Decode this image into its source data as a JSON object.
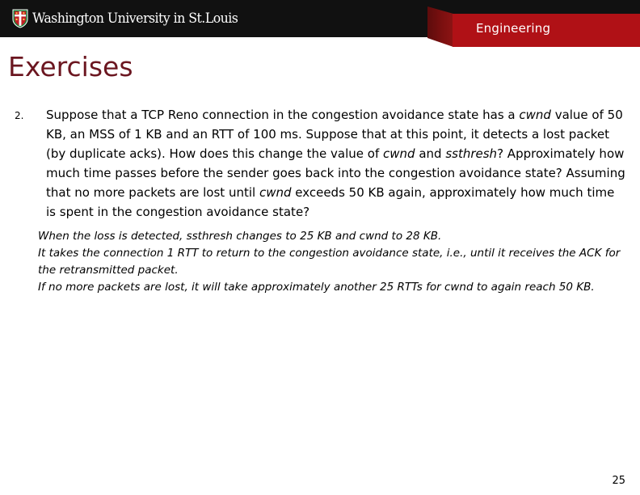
{
  "header": {
    "university_name": "Washington University in St.Louis",
    "crest_icon": "shield-crest-icon",
    "school_label": "Engineering",
    "bar_color": "#111111",
    "banner_color": "#b01116",
    "banner_fold_color": "#5d0c0c"
  },
  "slide": {
    "title": "Exercises",
    "title_color": "#6b1620",
    "page_number": "25"
  },
  "question": {
    "number": "2.",
    "segments": [
      {
        "text": "Suppose that a TCP Reno connection in the congestion avoidance state has a ",
        "italic": false
      },
      {
        "text": "cwnd",
        "italic": true
      },
      {
        "text": " value of 50 KB, an MSS of 1 KB and an RTT of 100 ms. Suppose that at this point, it detects a lost packet (by duplicate acks). How does this change the value of ",
        "italic": false
      },
      {
        "text": "cwnd",
        "italic": true
      },
      {
        "text": " and ",
        "italic": false
      },
      {
        "text": "ssthresh",
        "italic": true
      },
      {
        "text": "? Approximately how much time passes before the sender goes back into the congestion avoidance state? Assuming that no more packets are lost until ",
        "italic": false
      },
      {
        "text": "cwnd",
        "italic": true
      },
      {
        "text": " exceeds 50 KB again, approximately how much time is spent in the congestion avoidance state?",
        "italic": false
      }
    ]
  },
  "answer": {
    "lines": [
      "When the loss is detected, ssthresh changes to 25 KB and cwnd to 28 KB.",
      "It takes the connection 1 RTT to return to the congestion avoidance state, i.e., until it receives the ACK for the retransmitted packet.",
      "If no more packets are lost, it will take approximately another 25 RTTs for cwnd to again reach 50 KB."
    ]
  }
}
